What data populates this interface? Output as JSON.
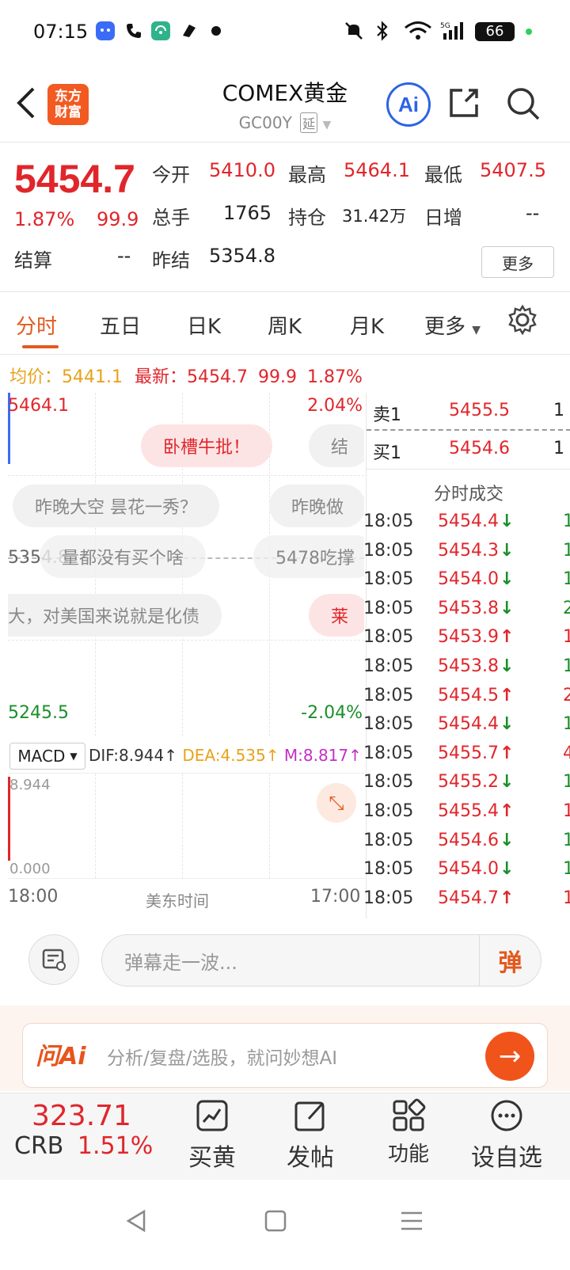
{
  "status_bar": {
    "time": "07:15",
    "battery": "66"
  },
  "header": {
    "logo_line1": "东方",
    "logo_line2": "财富",
    "title": "COMEX黄金",
    "subtitle": "GC00Y",
    "delayed_tag": "延",
    "ai_label": "Ai"
  },
  "quote": {
    "price": "5454.7",
    "change_pct": "1.87%",
    "change": "99.9",
    "open_label": "今开",
    "open": "5410.0",
    "high_label": "最高",
    "high": "5464.1",
    "low_label": "最低",
    "low": "5407.5",
    "volume_label": "总手",
    "volume": "1765",
    "oi_label": "持仓",
    "oi": "31.42万",
    "daily_inc_label": "日增",
    "daily_inc": "--",
    "settle_label": "结算",
    "settle": "--",
    "prev_settle_label": "昨结",
    "prev_settle": "5354.8",
    "more_label": "更多"
  },
  "tabs": [
    "分时",
    "五日",
    "日K",
    "周K",
    "月K",
    "更多"
  ],
  "info_line": {
    "avg_label": "均价：",
    "avg": "5441.1",
    "latest_label": "最新：",
    "latest": "5454.7",
    "change": "99.9",
    "pct": "1.87%"
  },
  "chart": {
    "max_price": "5464.1",
    "max_pct": "2.04%",
    "min_price": "5245.5",
    "min_pct": "-2.04%",
    "mid_price": "5354.8",
    "x_start": "18:00",
    "x_mid": "美东时间",
    "x_end": "17:00",
    "danmaku": [
      "卧槽牛批！",
      "结",
      "昨晚大空 昙花一秀？",
      "昨晚做",
      "量都没有买个啥",
      "5478吃撑",
      "大，对美国来说就是化债",
      "莱"
    ]
  },
  "macd": {
    "selector": "MACD",
    "dif": "DIF:8.944",
    "dea": "DEA:4.535",
    "m": "M:8.817",
    "top": "8.944",
    "bottom": "0.000"
  },
  "order_book": {
    "ask_label": "卖1",
    "ask_price": "5455.5",
    "ask_vol": "1",
    "bid_label": "买1",
    "bid_price": "5454.6",
    "bid_vol": "1",
    "trades_title": "分时成交"
  },
  "trades": [
    {
      "time": "18:05",
      "price": "5454.4",
      "dir": "down",
      "vol": "1"
    },
    {
      "time": "18:05",
      "price": "5454.3",
      "dir": "down",
      "vol": "1"
    },
    {
      "time": "18:05",
      "price": "5454.0",
      "dir": "down",
      "vol": "1"
    },
    {
      "time": "18:05",
      "price": "5453.8",
      "dir": "down",
      "vol": "2"
    },
    {
      "time": "18:05",
      "price": "5453.9",
      "dir": "up",
      "vol": "1"
    },
    {
      "time": "18:05",
      "price": "5453.8",
      "dir": "down",
      "vol": "1"
    },
    {
      "time": "18:05",
      "price": "5454.5",
      "dir": "up",
      "vol": "2"
    },
    {
      "time": "18:05",
      "price": "5454.4",
      "dir": "down",
      "vol": "1"
    },
    {
      "time": "18:05",
      "price": "5455.7",
      "dir": "up",
      "vol": "4"
    },
    {
      "time": "18:05",
      "price": "5455.2",
      "dir": "down",
      "vol": "1"
    },
    {
      "time": "18:05",
      "price": "5455.4",
      "dir": "up",
      "vol": "1"
    },
    {
      "time": "18:05",
      "price": "5454.6",
      "dir": "down",
      "vol": "1"
    },
    {
      "time": "18:05",
      "price": "5454.0",
      "dir": "down",
      "vol": "1"
    },
    {
      "time": "18:05",
      "price": "5454.7",
      "dir": "up",
      "vol": "1"
    }
  ],
  "danmaku_input": {
    "placeholder": "弹幕走一波...",
    "send_label": "弹"
  },
  "ai_bar": {
    "logo": "问Ai",
    "text": "分析/复盘/选股，就问妙想AI"
  },
  "toolbar": {
    "crb_value": "323.71",
    "crb_label": "CRB",
    "crb_pct": "1.51%",
    "items": [
      "买黄",
      "发帖",
      "功能",
      "设自选"
    ]
  },
  "colors": {
    "up": "#e0262b",
    "down": "#1a8f2a",
    "accent": "#e25a1f",
    "ai_blue": "#2c63e6"
  }
}
